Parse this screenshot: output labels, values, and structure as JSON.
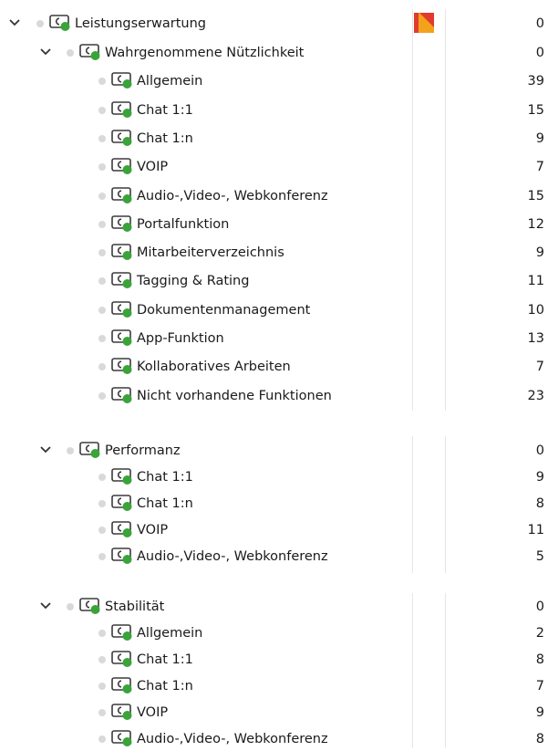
{
  "icons": {
    "expand": "chevron-down-icon",
    "code": "code-icon",
    "color": "color-marker-icon"
  },
  "colors": {
    "code_green": "#3aa33a",
    "marker_orange": "#f3a31b",
    "marker_red": "#e23a2e",
    "dot_gray": "#d9d9d9"
  },
  "tree": {
    "root": {
      "label": "Leistungserwartung",
      "count": "0"
    },
    "groups": [
      {
        "label": "Wahrgenommene Nützlichkeit",
        "count": "0",
        "items": [
          {
            "label": "Allgemein",
            "count": "39"
          },
          {
            "label": "Chat 1:1",
            "count": "15"
          },
          {
            "label": "Chat 1:n",
            "count": "9"
          },
          {
            "label": "VOIP",
            "count": "7"
          },
          {
            "label": "Audio-,Video-, Webkonferenz",
            "count": "15"
          },
          {
            "label": "Portalfunktion",
            "count": "12"
          },
          {
            "label": "Mitarbeiterverzeichnis",
            "count": "9"
          },
          {
            "label": "Tagging & Rating",
            "count": "11"
          },
          {
            "label": "Dokumentenmanagement",
            "count": "10"
          },
          {
            "label": "App-Funktion",
            "count": "13"
          },
          {
            "label": "Kollaboratives Arbeiten",
            "count": "7"
          },
          {
            "label": "Nicht vorhandene Funktionen",
            "count": "23"
          }
        ]
      },
      {
        "label": "Performanz",
        "count": "0",
        "items": [
          {
            "label": "Chat 1:1",
            "count": "9"
          },
          {
            "label": "Chat 1:n",
            "count": "8"
          },
          {
            "label": "VOIP",
            "count": "11"
          },
          {
            "label": "Audio-,Video-, Webkonferenz",
            "count": "5"
          }
        ]
      },
      {
        "label": "Stabilität",
        "count": "0",
        "items": [
          {
            "label": "Allgemein",
            "count": "2"
          },
          {
            "label": "Chat 1:1",
            "count": "8"
          },
          {
            "label": "Chat 1:n",
            "count": "7"
          },
          {
            "label": "VOIP",
            "count": "9"
          },
          {
            "label": "Audio-,Video-, Webkonferenz",
            "count": "8"
          }
        ]
      }
    ]
  }
}
